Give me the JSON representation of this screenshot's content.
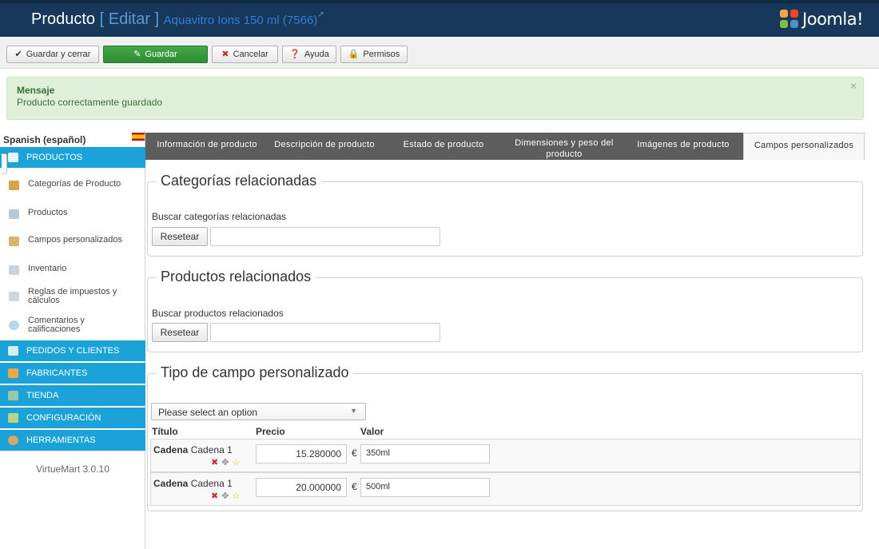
{
  "header": {
    "title": "Producto",
    "action_label": "[ Editar ]",
    "subtitle": "Aquavitro Ions 150 ml (7566)",
    "external_icon": "external-link-icon",
    "logo_text": "Joomla!"
  },
  "toolbar": {
    "save_close": "Guardar y cerrar",
    "save": "Guardar",
    "cancel": "Cancelar",
    "help": "Ayuda",
    "permissions": "Permisos"
  },
  "message": {
    "heading": "Mensaje",
    "text": "Producto correctamente guardado",
    "close": "×"
  },
  "sidebar": {
    "language": "Spanish (español)",
    "sections": [
      {
        "label": "PRODUCTOS",
        "icon": "products-icon"
      },
      {
        "label": "PEDIDOS Y CLIENTES",
        "icon": "orders-icon"
      },
      {
        "label": "FABRICANTES",
        "icon": "manufacturers-icon"
      },
      {
        "label": "TIENDA",
        "icon": "shop-icon"
      },
      {
        "label": "CONFIGURACIÓN",
        "icon": "configuration-icon"
      },
      {
        "label": "HERRAMIENTAS",
        "icon": "tools-icon"
      }
    ],
    "items": [
      {
        "label": "Categorías de Producto",
        "icon": "categories-icon"
      },
      {
        "label": "Productos",
        "icon": "product-list-icon"
      },
      {
        "label": "Campos personalizados",
        "icon": "custom-fields-icon"
      },
      {
        "label": "Inventario",
        "icon": "inventory-icon"
      },
      {
        "label": "Reglas de impuestos y cálculos",
        "icon": "tax-rules-icon"
      },
      {
        "label": "Comentarios y calificaciones",
        "icon": "reviews-icon"
      }
    ],
    "version": "VirtueMart 3.0.10"
  },
  "tabs": [
    {
      "label": "Información de producto"
    },
    {
      "label": "Descripción de producto"
    },
    {
      "label": "Estado de producto"
    },
    {
      "label": "Dimensiones y peso del producto"
    },
    {
      "label": "Imágenes de producto"
    },
    {
      "label": "Campos personalizados"
    }
  ],
  "related_categories": {
    "legend": "Categorías relacionadas",
    "search_label": "Buscar categorías relacionadas",
    "reset": "Resetear",
    "value": ""
  },
  "related_products": {
    "legend": "Productos relacionados",
    "search_label": "Buscar productos relacionados",
    "reset": "Resetear",
    "value": ""
  },
  "custom_field": {
    "legend": "Tipo de campo personalizado",
    "select_value": "Please select an option",
    "columns": [
      "Título",
      "Precio",
      "Valor"
    ],
    "rows": [
      {
        "type": "Cadena",
        "name": "Cadena 1",
        "price": "15.280000",
        "currency": "€",
        "value": "350ml"
      },
      {
        "type": "Cadena",
        "name": "Cadena 1",
        "price": "20.000000",
        "currency": "€",
        "value": "500ml"
      }
    ]
  },
  "colors": {
    "header_bg": "#17385a",
    "sidebar_accent": "#1aa2d9",
    "save_green": "#2e8c34",
    "alert_bg": "#dff0d8",
    "tabs_bg": "#5d5d5d"
  }
}
